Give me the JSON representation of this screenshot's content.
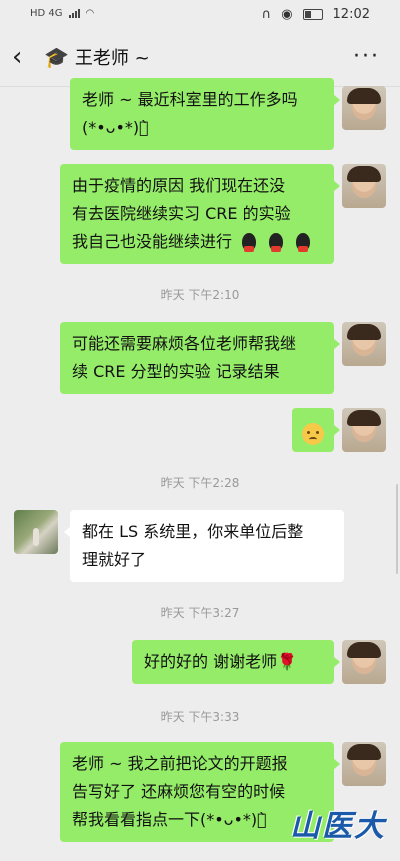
{
  "status_bar": {
    "network_label": "HD 4G",
    "time": "12:02"
  },
  "nav": {
    "title": "王老师 ~",
    "back_icon": "chevron-left-icon",
    "more_icon": "more-dots-icon"
  },
  "messages": [
    {
      "from": "me",
      "lines": [
        "老师 ~ 最近科室里的工作多吗",
        "(*•ᴗ•*)ง̀"
      ]
    },
    {
      "from": "me",
      "lines": [
        "由于疫情的原因 我们现在还没",
        "有去医院继续实习 CRE 的实验",
        "我自己也没能继续进行"
      ]
    },
    {
      "from": "me",
      "lines": [
        "可能还需要麻烦各位老师帮我继",
        "续 CRE 分型的实验 记录结果"
      ]
    },
    {
      "from": "other",
      "lines": [
        "都在 LS 系统里，你来单位后整",
        "理就好了"
      ]
    },
    {
      "from": "me",
      "lines": [
        "好的好的 谢谢老师🌹"
      ]
    },
    {
      "from": "me",
      "lines": [
        "老师 ~ 我之前把论文的开题报",
        "告写好了 还麻烦您有空的时候",
        "帮我看看指点一下(*•ᴗ•*)ง̀"
      ]
    }
  ],
  "timestamps": [
    "昨天 下午2:10",
    "昨天 下午2:28",
    "昨天 下午3:27",
    "昨天 下午3:33"
  ],
  "watermark": "山医大",
  "colors": {
    "my_bubble": "#95ec69",
    "other_bubble": "#ffffff",
    "background": "#ededed"
  }
}
